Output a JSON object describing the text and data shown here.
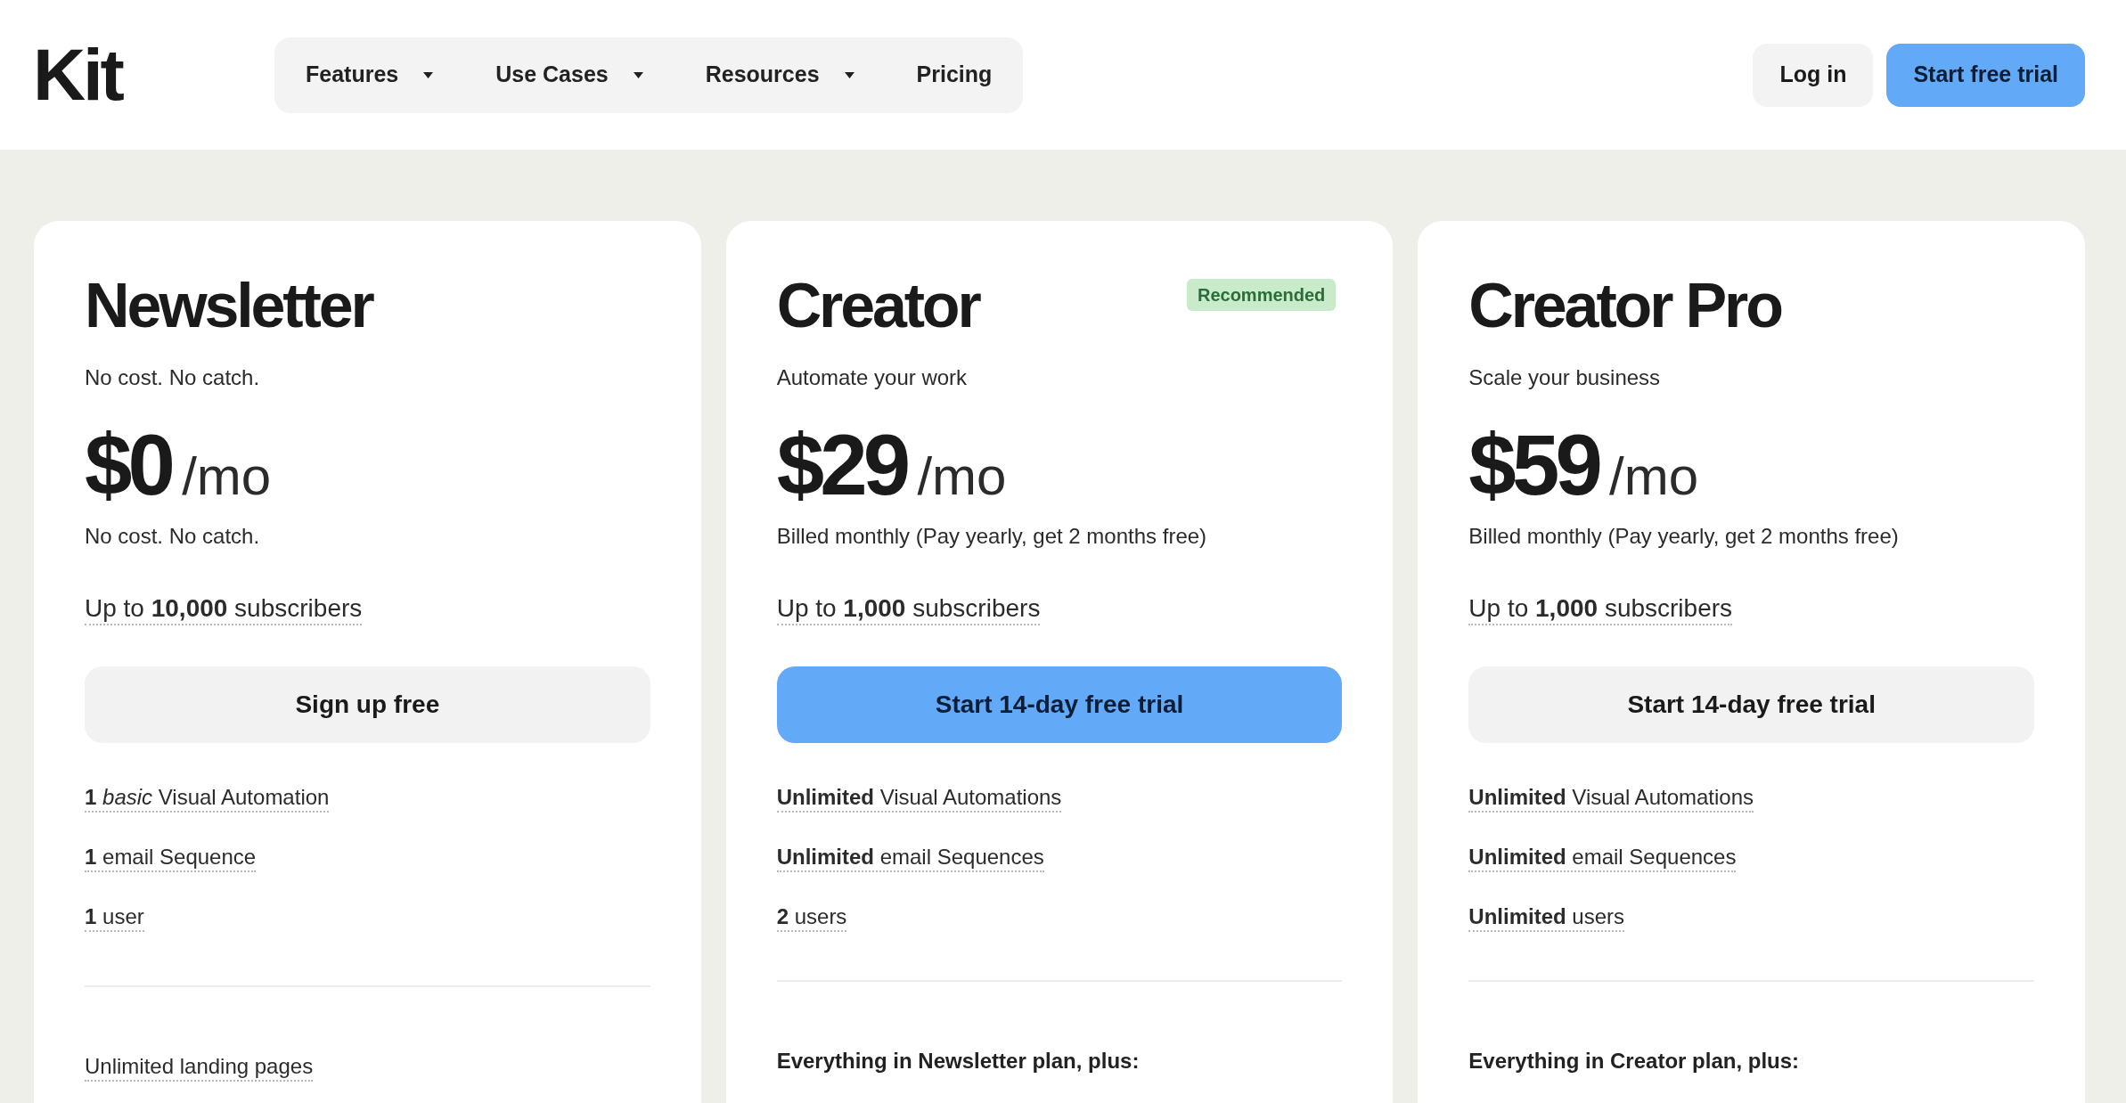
{
  "header": {
    "logo": "Kit",
    "nav": [
      {
        "label": "Features",
        "has_menu": true
      },
      {
        "label": "Use Cases",
        "has_menu": true
      },
      {
        "label": "Resources",
        "has_menu": true
      },
      {
        "label": "Pricing",
        "has_menu": false
      }
    ],
    "actions": [
      {
        "label": "Log in",
        "kind": "secondary"
      },
      {
        "label": "Start free trial",
        "kind": "primary"
      }
    ]
  },
  "plans": [
    {
      "name": "Newsletter",
      "tagline": "No cost. No catch.",
      "price": "$0",
      "period": "/mo",
      "price_note": "No cost. No catch.",
      "subscribers": "Up to **10,000** subscribers",
      "cta": {
        "label": "Sign up free",
        "kind": "secondary"
      },
      "features": [
        "**1** *basic* Visual Automation",
        "**1** email Sequence",
        "**1** user"
      ],
      "more": [
        {
          "kind": "feature",
          "text": "Unlimited landing pages"
        }
      ]
    },
    {
      "name": "Creator",
      "badge": "Recommended",
      "tagline": "Automate your work",
      "price": "$29",
      "period": "/mo",
      "price_note": "Billed monthly (Pay yearly, get 2 months free)",
      "subscribers": "Up to **1,000** subscribers",
      "cta": {
        "label": "Start 14-day free trial",
        "kind": "primary"
      },
      "features": [
        "**Unlimited** Visual Automations",
        "**Unlimited** email Sequences",
        "**2** users"
      ],
      "more": [
        {
          "kind": "heading",
          "text": "Everything in Newsletter plan, plus:"
        }
      ]
    },
    {
      "name": "Creator Pro",
      "tagline": "Scale your business",
      "price": "$59",
      "period": "/mo",
      "price_note": "Billed monthly (Pay yearly, get 2 months free)",
      "subscribers": "Up to **1,000** subscribers",
      "cta": {
        "label": "Start 14-day free trial",
        "kind": "secondary"
      },
      "features": [
        "**Unlimited** Visual Automations",
        "**Unlimited** email Sequences",
        "**Unlimited** users"
      ],
      "more": [
        {
          "kind": "heading",
          "text": "Everything in Creator plan, plus:"
        }
      ]
    }
  ]
}
